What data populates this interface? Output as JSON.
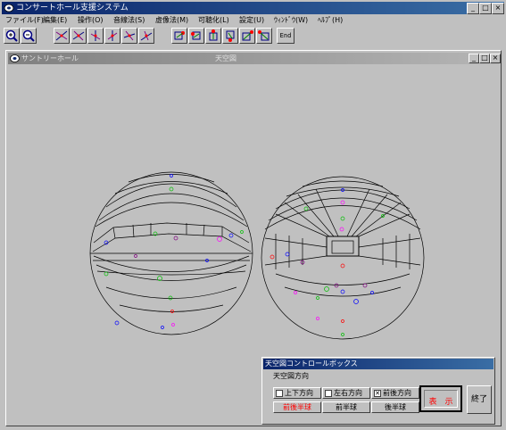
{
  "window": {
    "title": "コンサートホール支援システム"
  },
  "menu": {
    "items": [
      "ファイル(F)",
      "編集(E)",
      "操作(O)",
      "音線法(S)",
      "虚像法(M)",
      "可聴化(L)",
      "設定(U)",
      "ｳｨﾝﾄﾞｳ(W)",
      "ﾍﾙﾌﾟ(H)"
    ]
  },
  "toolbar": {
    "end_label": "End"
  },
  "child_window": {
    "title": "サントリーホール",
    "subtitle": "天空図"
  },
  "control_box": {
    "title": "天空図コントロールボックス",
    "section_label": "天空図方向",
    "checkboxes": [
      {
        "label": "上下方向",
        "checked": false
      },
      {
        "label": "左右方向",
        "checked": false
      },
      {
        "label": "前後方向",
        "checked": true
      }
    ],
    "hemi_buttons": [
      "前後半球",
      "前半球",
      "後半球"
    ],
    "show_label": "表　示",
    "end_label": "終了"
  },
  "colors": {
    "title_active": "#0a246a",
    "hemi_active_text": "#ff0000",
    "show_text": "#ff0000"
  }
}
